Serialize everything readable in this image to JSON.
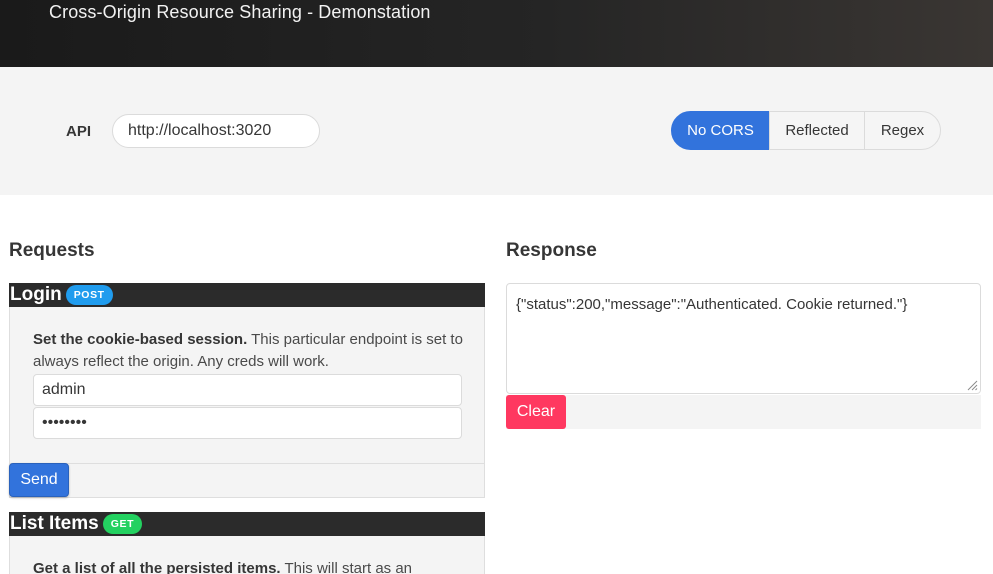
{
  "header": {
    "title": "Cross-Origin Resource Sharing - Demonstation"
  },
  "api_bar": {
    "label": "API",
    "url_value": "http://localhost:3020",
    "modes": [
      {
        "label": "No CORS",
        "active": true
      },
      {
        "label": "Reflected",
        "active": false
      },
      {
        "label": "Regex",
        "active": false
      }
    ]
  },
  "requests": {
    "heading": "Requests",
    "login": {
      "title": "Login",
      "method": "POST",
      "desc_bold": "Set the cookie-based session.",
      "desc_rest": " This particular endpoint is set to always reflect the origin. Any creds will work.",
      "username_value": "admin",
      "password_value": "password",
      "send_label": "Send"
    },
    "list_items": {
      "title": "List Items",
      "method": "GET",
      "desc_bold": "Get a list of all the persisted items.",
      "desc_rest": " This will start as an"
    }
  },
  "response": {
    "heading": "Response",
    "body": "{\"status\":200,\"message\":\"Authenticated. Cookie returned.\"}",
    "clear_label": "Clear"
  },
  "colors": {
    "primary": "#3273dc",
    "info": "#209cee",
    "success": "#23d160",
    "danger": "#ff3860",
    "card_header": "#2b2b2b"
  }
}
